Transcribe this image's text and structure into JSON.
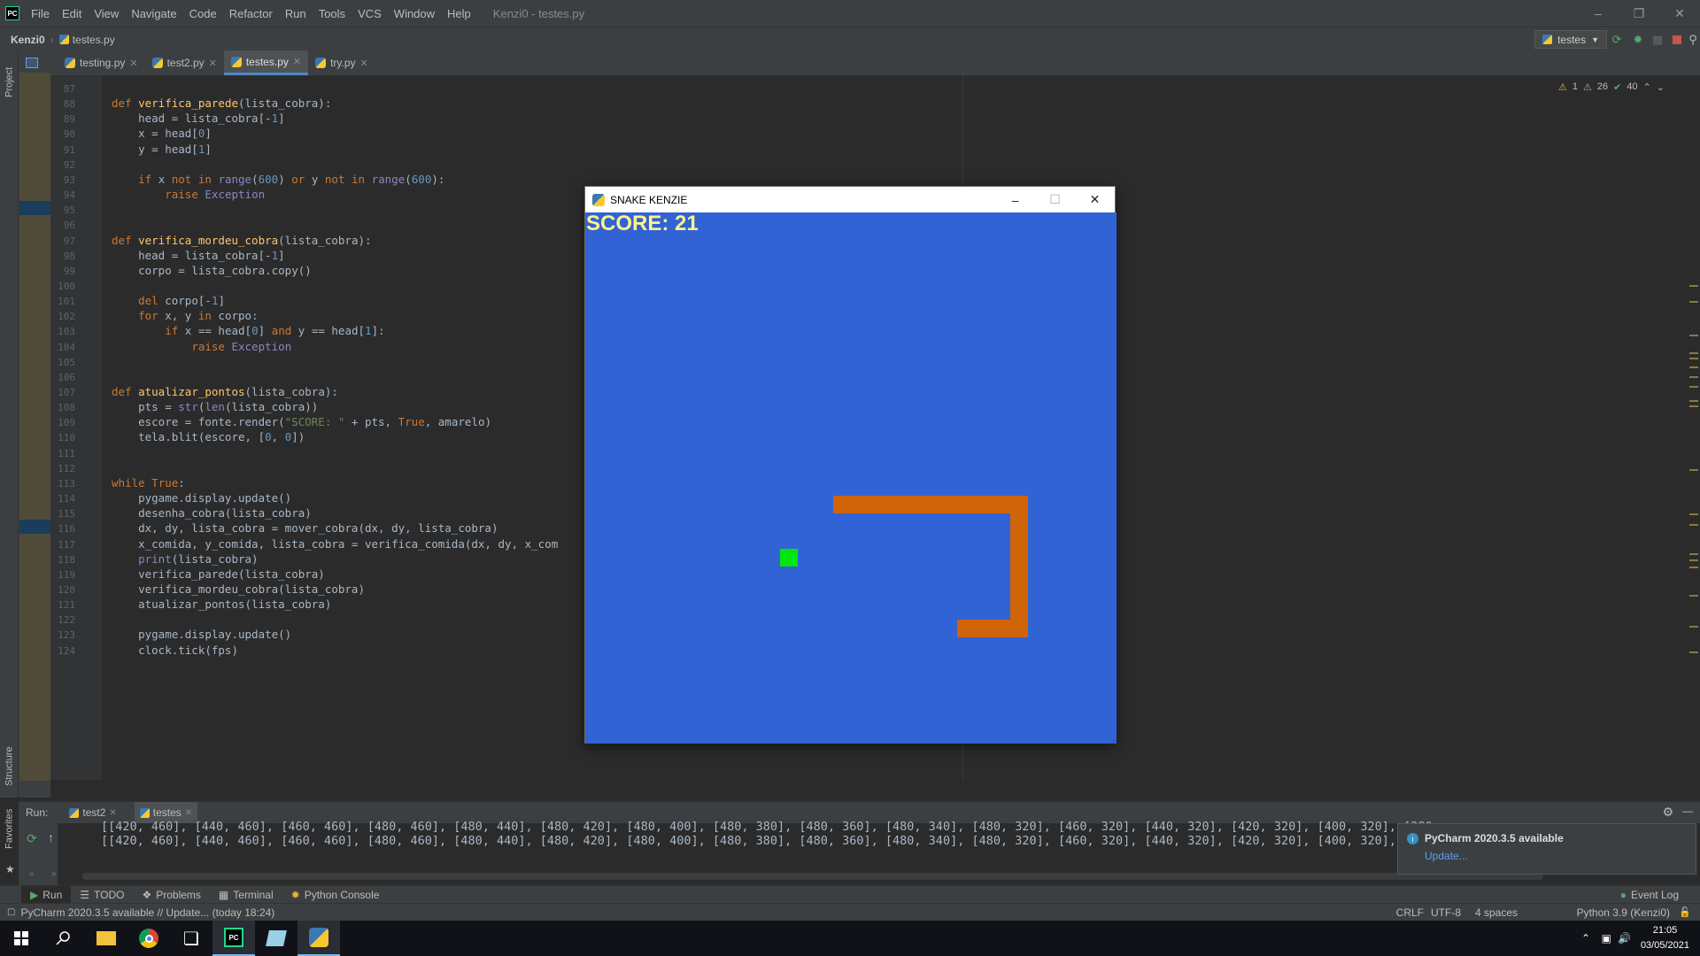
{
  "app": {
    "logo_text": "PC",
    "window_title": "Kenzi0 - testes.py",
    "menu": [
      "File",
      "Edit",
      "View",
      "Navigate",
      "Code",
      "Refactor",
      "Run",
      "Tools",
      "VCS",
      "Window",
      "Help"
    ]
  },
  "navbar": {
    "project": "Kenzi0",
    "file": "testes.py",
    "run_config": "testes"
  },
  "sidebar": {
    "project_label": "Project",
    "structure_label": "Structure",
    "favorites_label": "Favorites"
  },
  "tabs": [
    {
      "label": "testing.py",
      "active": false
    },
    {
      "label": "test2.py",
      "active": false
    },
    {
      "label": "testes.py",
      "active": true
    },
    {
      "label": "try.py",
      "active": false
    }
  ],
  "inspections": {
    "warnings": "1",
    "weak_warnings": "26",
    "ok": "40"
  },
  "editor": {
    "lines": [
      {
        "n": "87",
        "code": ""
      },
      {
        "n": "88",
        "code": "def verifica_parede(lista_cobra):"
      },
      {
        "n": "89",
        "code": "    head = lista_cobra[-1]"
      },
      {
        "n": "90",
        "code": "    x = head[0]"
      },
      {
        "n": "91",
        "code": "    y = head[1]"
      },
      {
        "n": "92",
        "code": ""
      },
      {
        "n": "93",
        "code": "    if x not in range(600) or y not in range(600):"
      },
      {
        "n": "94",
        "code": "        raise Exception"
      },
      {
        "n": "95",
        "code": ""
      },
      {
        "n": "96",
        "code": ""
      },
      {
        "n": "97",
        "code": "def verifica_mordeu_cobra(lista_cobra):"
      },
      {
        "n": "98",
        "code": "    head = lista_cobra[-1]"
      },
      {
        "n": "99",
        "code": "    corpo = lista_cobra.copy()"
      },
      {
        "n": "100",
        "code": ""
      },
      {
        "n": "101",
        "code": "    del corpo[-1]"
      },
      {
        "n": "102",
        "code": "    for x, y in corpo:"
      },
      {
        "n": "103",
        "code": "        if x == head[0] and y == head[1]:"
      },
      {
        "n": "104",
        "code": "            raise Exception"
      },
      {
        "n": "105",
        "code": ""
      },
      {
        "n": "106",
        "code": ""
      },
      {
        "n": "107",
        "code": "def atualizar_pontos(lista_cobra):"
      },
      {
        "n": "108",
        "code": "    pts = str(len(lista_cobra))"
      },
      {
        "n": "109",
        "code": "    escore = fonte.render(\"SCORE: \" + pts, True, amarelo)"
      },
      {
        "n": "110",
        "code": "    tela.blit(escore, [0, 0])"
      },
      {
        "n": "111",
        "code": ""
      },
      {
        "n": "112",
        "code": ""
      },
      {
        "n": "113",
        "code": "while True:"
      },
      {
        "n": "114",
        "code": "    pygame.display.update()"
      },
      {
        "n": "115",
        "code": "    desenha_cobra(lista_cobra)"
      },
      {
        "n": "116",
        "code": "    dx, dy, lista_cobra = mover_cobra(dx, dy, lista_cobra)"
      },
      {
        "n": "117",
        "code": "    x_comida, y_comida, lista_cobra = verifica_comida(dx, dy, x_com"
      },
      {
        "n": "118",
        "code": "    print(lista_cobra)"
      },
      {
        "n": "119",
        "code": "    verifica_parede(lista_cobra)"
      },
      {
        "n": "120",
        "code": "    verifica_mordeu_cobra(lista_cobra)"
      },
      {
        "n": "121",
        "code": "    atualizar_pontos(lista_cobra)"
      },
      {
        "n": "122",
        "code": ""
      },
      {
        "n": "123",
        "code": "    pygame.display.update()"
      },
      {
        "n": "124",
        "code": "    clock.tick(fps)"
      }
    ]
  },
  "game": {
    "window_title": "SNAKE KENZIE",
    "score_text": "SCORE: 21",
    "background_color": "#3163d5",
    "snake_color": "#cf6408",
    "food_color": "#00e60f",
    "score_color": "#fff488"
  },
  "run_panel": {
    "label": "Run:",
    "tabs": [
      "test2",
      "testes"
    ],
    "output_line_1": "[[420, 460], [440, 460], [460, 460], [480, 460], [480, 440], [480, 420], [480, 400], [480, 380], [480, 360], [480, 340], [480, 320], [460, 320], [440, 320], [420, 320], [400, 320], [380,",
    "output_line_2": "[[420, 460], [440, 460], [460, 460], [480, 460], [480, 440], [480, 420], [480, 400], [480, 380], [480, 360], [480, 340], [480, 320], [460, 320], [440, 320], [420, 320], [400, 320], [380,"
  },
  "notification": {
    "title": "PyCharm 2020.3.5 available",
    "link": "Update..."
  },
  "tool_tabs": [
    "Run",
    "TODO",
    "Problems",
    "Terminal",
    "Python Console"
  ],
  "event_log": "Event Log",
  "statusbar": {
    "message": "PyCharm 2020.3.5 available // Update... (today 18:24)",
    "line_sep": "CRLF",
    "encoding": "UTF-8",
    "indent": "4 spaces",
    "interpreter": "Python 3.9 (Kenzi0)"
  },
  "taskbar": {
    "time": "21:05",
    "date": "03/05/2021"
  }
}
